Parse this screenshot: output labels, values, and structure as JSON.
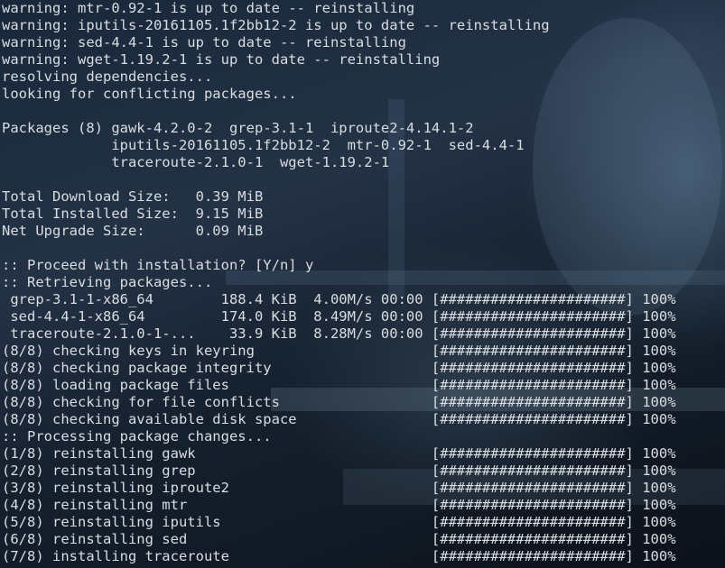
{
  "terminal": {
    "lines": [
      "warning: mtr-0.92-1 is up to date -- reinstalling",
      "warning: iputils-20161105.1f2bb12-2 is up to date -- reinstalling",
      "warning: sed-4.4-1 is up to date -- reinstalling",
      "warning: wget-1.19.2-1 is up to date -- reinstalling",
      "resolving dependencies...",
      "looking for conflicting packages...",
      "",
      "Packages (8) gawk-4.2.0-2  grep-3.1-1  iproute2-4.14.1-2",
      "             iputils-20161105.1f2bb12-2  mtr-0.92-1  sed-4.4-1",
      "             traceroute-2.1.0-1  wget-1.19.2-1",
      "",
      "Total Download Size:   0.39 MiB",
      "Total Installed Size:  9.15 MiB",
      "Net Upgrade Size:      0.09 MiB",
      "",
      ":: Proceed with installation? [Y/n] y",
      ":: Retrieving packages...",
      " grep-3.1-1-x86_64        188.4 KiB  4.00M/s 00:00 [######################] 100%",
      " sed-4.4-1-x86_64         174.0 KiB  8.49M/s 00:00 [######################] 100%",
      " traceroute-2.1.0-1-...    33.9 KiB  8.28M/s 00:00 [######################] 100%",
      "(8/8) checking keys in keyring                     [######################] 100%",
      "(8/8) checking package integrity                   [######################] 100%",
      "(8/8) loading package files                        [######################] 100%",
      "(8/8) checking for file conflicts                  [######################] 100%",
      "(8/8) checking available disk space                [######################] 100%",
      ":: Processing package changes...",
      "(1/8) reinstalling gawk                            [######################] 100%",
      "(2/8) reinstalling grep                            [######################] 100%",
      "(3/8) reinstalling iproute2                        [######################] 100%",
      "(4/8) reinstalling mtr                             [######################] 100%",
      "(5/8) reinstalling iputils                         [######################] 100%",
      "(6/8) reinstalling sed                             [######################] 100%",
      "(7/8) installing traceroute                        [######################] 100%"
    ]
  },
  "colors": {
    "foreground": "#d9dde1",
    "background": "#0b1420"
  }
}
